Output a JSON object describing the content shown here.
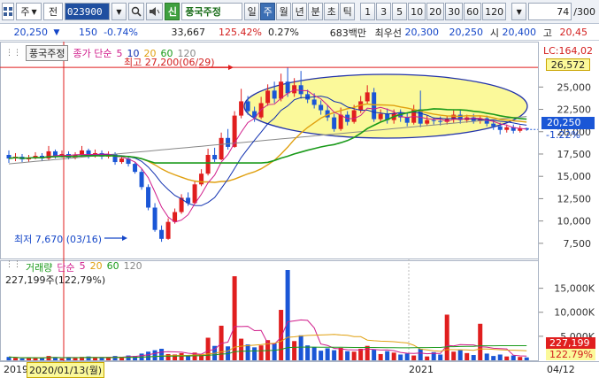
{
  "toolbar": {
    "market": "주",
    "mode": "전",
    "code": "023900",
    "stock_name": "풍국주정",
    "tag": "신",
    "periods": [
      "일",
      "주",
      "월",
      "년",
      "분",
      "초",
      "틱"
    ],
    "active_period": "주",
    "intervals": [
      "1",
      "3",
      "5",
      "10",
      "20",
      "30",
      "60",
      "120"
    ],
    "zoom": "74",
    "zoom_total": "/300"
  },
  "quote": {
    "price": "20,250",
    "change": "150",
    "change_pct": "-0.74%",
    "volume": "33,667",
    "volume_ratio": "125.42%",
    "turnover": "0.27%",
    "amount": "683백만",
    "best_ask_label": "최우선",
    "best_ask": "20,300",
    "best_bid": "20,250",
    "open_label": "시",
    "open": "20,400",
    "high_label": "고",
    "high": "20,45"
  },
  "main_legend": {
    "name": "풍국주정",
    "close_label": "종가 단순",
    "ma": [
      {
        "label": "5",
        "color": "#d01c8b"
      },
      {
        "label": "10",
        "color": "#1030b0"
      },
      {
        "label": "20",
        "color": "#e0a010"
      },
      {
        "label": "60",
        "color": "#1a9a1a"
      },
      {
        "label": "120",
        "color": "#888888"
      }
    ]
  },
  "annotations": {
    "high": "최고 27,200(06/29)",
    "low": "최저 7,670 (03/16)",
    "last_price": "20,250",
    "last_change": "-1.22%",
    "lc": "LC:164,02",
    "lc_value": "26,572"
  },
  "price_axis": [
    "25,000",
    "22,500",
    "20,000",
    "17,500",
    "15,000",
    "12,500",
    "10,000",
    "7,500"
  ],
  "volume_legend": {
    "name": "거래량",
    "type": "단순",
    "ma": [
      {
        "label": "5",
        "color": "#d01c8b"
      },
      {
        "label": "20",
        "color": "#e0a010"
      },
      {
        "label": "60",
        "color": "#1a9a1a"
      },
      {
        "label": "120",
        "color": "#888888"
      }
    ],
    "current": "227,199주(122,79%)",
    "last_value": "227,199",
    "last_pct": "122.79%"
  },
  "volume_axis": [
    "15,000K",
    "10,000K",
    "5,000K"
  ],
  "x_axis": {
    "year_start": "2019",
    "cursor_date": "2020/01/13(월)",
    "year_2021": "2021",
    "right_date": "04/12"
  },
  "colors": {
    "up": "#e01e1e",
    "down": "#1a56d6",
    "highlight": "#fbf99a"
  },
  "chart_data": {
    "type": "candlestick",
    "ylim": [
      6000,
      28500
    ],
    "candles": [
      [
        17400,
        17000,
        17900,
        16500
      ],
      [
        17000,
        17200,
        17600,
        16700
      ],
      [
        17200,
        16900,
        17500,
        16600
      ],
      [
        16900,
        17100,
        17400,
        16600
      ],
      [
        17100,
        17300,
        17700,
        16900
      ],
      [
        17300,
        17000,
        17600,
        16700
      ],
      [
        17000,
        17800,
        18400,
        16800
      ],
      [
        17800,
        17300,
        18000,
        17000
      ],
      [
        17300,
        17500,
        17900,
        17100
      ],
      [
        17500,
        17100,
        17800,
        16900
      ],
      [
        17100,
        17400,
        17700,
        16900
      ],
      [
        17400,
        17900,
        18400,
        17200
      ],
      [
        17900,
        17300,
        18100,
        17000
      ],
      [
        17300,
        17600,
        18000,
        17100
      ],
      [
        17600,
        17200,
        17900,
        16900
      ],
      [
        17200,
        17500,
        17800,
        17000
      ],
      [
        17500,
        16600,
        17700,
        16300
      ],
      [
        16600,
        17000,
        17300,
        16400
      ],
      [
        17000,
        16400,
        17200,
        16100
      ],
      [
        16400,
        15500,
        16600,
        15300
      ],
      [
        15500,
        13800,
        15800,
        13500
      ],
      [
        13800,
        11500,
        14100,
        11200
      ],
      [
        11500,
        9000,
        12000,
        8800
      ],
      [
        9000,
        8000,
        9500,
        7670
      ],
      [
        8000,
        9900,
        10300,
        7900
      ],
      [
        9900,
        11000,
        11400,
        9700
      ],
      [
        11000,
        12600,
        13000,
        10800
      ],
      [
        12600,
        12000,
        13200,
        11700
      ],
      [
        12000,
        14100,
        14500,
        11900
      ],
      [
        14100,
        15300,
        15800,
        13900
      ],
      [
        15300,
        17400,
        18100,
        15100
      ],
      [
        17400,
        16900,
        18200,
        16600
      ],
      [
        16900,
        19300,
        19900,
        16800
      ],
      [
        19300,
        18300,
        20300,
        18000
      ],
      [
        18300,
        21800,
        22300,
        18200
      ],
      [
        21800,
        23400,
        24800,
        21500
      ],
      [
        23400,
        22300,
        24000,
        21900
      ],
      [
        22300,
        21600,
        22800,
        21100
      ],
      [
        21600,
        23200,
        23900,
        21400
      ],
      [
        23200,
        24600,
        25300,
        22900
      ],
      [
        24600,
        23700,
        25600,
        23200
      ],
      [
        23700,
        25600,
        26500,
        23400
      ],
      [
        25600,
        24300,
        27200,
        23900
      ],
      [
        24300,
        25200,
        26000,
        23900
      ],
      [
        25200,
        24200,
        26800,
        23700
      ],
      [
        24200,
        23600,
        24700,
        23200
      ],
      [
        23600,
        23000,
        24300,
        22600
      ],
      [
        23000,
        22400,
        23500,
        21900
      ],
      [
        22400,
        21600,
        23000,
        21200
      ],
      [
        21600,
        20300,
        22000,
        20000
      ],
      [
        20300,
        21900,
        22700,
        20100
      ],
      [
        21900,
        21100,
        22300,
        20700
      ],
      [
        21100,
        22400,
        23000,
        20900
      ],
      [
        22400,
        23400,
        24000,
        22100
      ],
      [
        23400,
        24400,
        25200,
        23100
      ],
      [
        24400,
        21400,
        24900,
        21100
      ],
      [
        21400,
        22000,
        22500,
        21100
      ],
      [
        22000,
        21300,
        22600,
        20900
      ],
      [
        21300,
        22100,
        22500,
        20900
      ],
      [
        22100,
        21600,
        22500,
        21100
      ],
      [
        21600,
        21000,
        22100,
        20600
      ],
      [
        21000,
        22500,
        23000,
        20800
      ],
      [
        22500,
        20900,
        24600,
        20500
      ],
      [
        20900,
        21300,
        21800,
        20700
      ],
      [
        21300,
        21200,
        21600,
        20800
      ],
      [
        21200,
        21100,
        21700,
        20700
      ],
      [
        21100,
        21400,
        21800,
        20800
      ],
      [
        21400,
        21900,
        22400,
        21000
      ],
      [
        21900,
        21300,
        22400,
        20900
      ],
      [
        21300,
        21600,
        21900,
        21000
      ],
      [
        21600,
        21200,
        22000,
        20900
      ],
      [
        21200,
        21500,
        21800,
        20900
      ],
      [
        21500,
        20900,
        21800,
        20600
      ],
      [
        20900,
        20600,
        21300,
        20200
      ],
      [
        20600,
        20200,
        21000,
        19700
      ],
      [
        20200,
        20500,
        20800,
        19900
      ],
      [
        20500,
        20100,
        20800,
        19800
      ],
      [
        20100,
        20400,
        20700,
        19900
      ],
      [
        20400,
        20250,
        20450,
        20100
      ]
    ],
    "ma60": [
      14800,
      15200,
      15500,
      15600,
      15800,
      16000,
      16300,
      16600,
      16900,
      17000,
      17300,
      17600,
      17700,
      17900,
      18000,
      18200
    ],
    "volume_k": [
      700,
      500,
      400,
      600,
      450,
      500,
      900,
      550,
      400,
      600,
      450,
      700,
      800,
      500,
      600,
      550,
      900,
      700,
      1000,
      900,
      1400,
      1800,
      2100,
      2400,
      1300,
      1200,
      1500,
      1000,
      1600,
      1100,
      4700,
      3000,
      7200,
      2900,
      17500,
      4500,
      3300,
      2700,
      3100,
      4200,
      3500,
      10500,
      18800,
      4000,
      5200,
      3100,
      2700,
      2000,
      2500,
      2100,
      2600,
      1900,
      1800,
      2400,
      3000,
      2200,
      1300,
      1900,
      1600,
      1200,
      1400,
      1000,
      2400,
      800,
      1700,
      1200,
      9500,
      1800,
      2100,
      1500,
      1100,
      7600,
      1400,
      900,
      1200,
      800,
      1000,
      700,
      600
    ],
    "volume_ylim": [
      0,
      18800
    ]
  }
}
